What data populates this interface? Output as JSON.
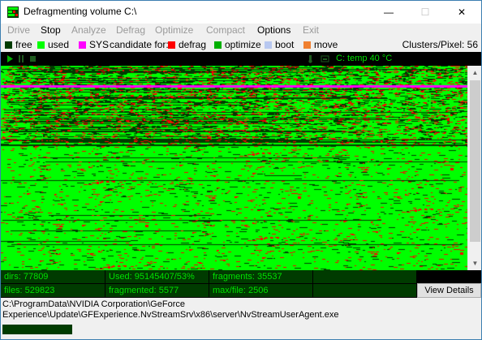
{
  "window": {
    "title": "Defragmenting volume C:\\",
    "minimize_glyph": "—",
    "maximize_glyph": "☐",
    "close_glyph": "✕"
  },
  "menu": [
    {
      "label": "Drive",
      "enabled": false
    },
    {
      "label": "Stop",
      "enabled": true
    },
    {
      "label": "Analyze",
      "enabled": false
    },
    {
      "label": "Defrag",
      "enabled": false
    },
    {
      "label": "Optimize",
      "enabled": false
    },
    {
      "label": "Compact",
      "enabled": false
    },
    {
      "label": "Options",
      "enabled": true
    },
    {
      "label": "Exit",
      "enabled": false
    }
  ],
  "legend": {
    "free": "free",
    "used": "used",
    "sys": "SYS",
    "candidate": "candidate for:",
    "defrag": "defrag",
    "optimize": "optimize",
    "boot": "boot",
    "move": "move",
    "clusters_per_pixel": "Clusters/Pixel: 56",
    "colors": {
      "free": "#003b00",
      "used": "#00ff00",
      "sys": "#ff00ff",
      "defrag": "#ff0000",
      "optimize": "#00b000",
      "boot": "#b8c8f0",
      "move": "#f08030"
    }
  },
  "toolbar": {
    "play_icon": "play-icon",
    "pause_icon": "pause-icon",
    "stop_icon": "stop-icon",
    "temperature": "C: temp 40 °C"
  },
  "stats": {
    "dirs": "dirs: 77809",
    "used": "Used:  95145407/53%",
    "fragments": "fragments: 35537",
    "files": "files: 529823",
    "fragmented": "fragmented: 5577",
    "max_file": "max/file: 2506",
    "view_details": "View Details"
  },
  "current_file": {
    "line1": "C:\\ProgramData\\NVIDIA Corporation\\GeForce",
    "line2": "Experience\\Update\\GFExperience.NvStreamSrv\\x86\\server\\NvStreamUserAgent.exe"
  }
}
